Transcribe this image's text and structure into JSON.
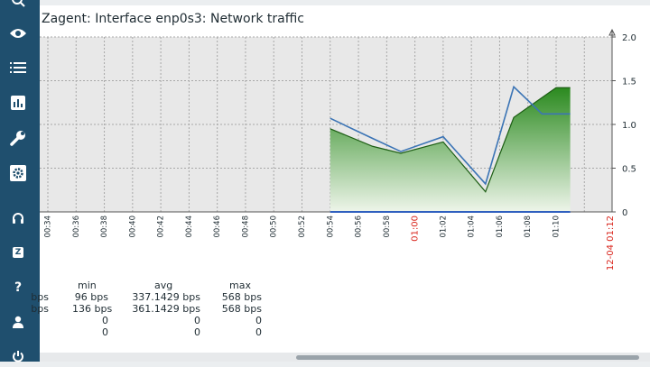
{
  "window": {
    "title": "Zagent: Interface enp0s3: Network traffic"
  },
  "sidebar": {
    "icons": [
      "search-icon",
      "eye-icon",
      "list-icon",
      "chart-icon",
      "wrench-icon",
      "cog-icon",
      "headset-icon",
      "zabbix-icon",
      "help-icon",
      "user-icon",
      "power-icon"
    ],
    "zabbix_label": "Z",
    "help_label": "?"
  },
  "chart_data": {
    "type": "area",
    "title": "Zagent: Interface enp0s3: Network traffic",
    "x": [
      "00:34",
      "00:36",
      "00:38",
      "00:40",
      "00:42",
      "00:44",
      "00:46",
      "00:48",
      "00:50",
      "00:52",
      "00:54",
      "00:56",
      "00:58",
      "01:00",
      "01:02",
      "01:04",
      "01:06",
      "01:08",
      "01:10",
      "12-04 01:12"
    ],
    "highlight_ticks": [
      "01:00",
      "12-04 01:12"
    ],
    "ylim": [
      0,
      2.0
    ],
    "yticks": [
      "0",
      "0.5",
      "1.0",
      "1.5",
      "2.0"
    ],
    "grid": true,
    "series": [
      {
        "style": "area",
        "color": "#2b8a1f",
        "points": [
          [
            "00:54",
            0.95
          ],
          [
            "00:57",
            0.75
          ],
          [
            "00:59",
            0.67
          ],
          [
            "01:02",
            0.8
          ],
          [
            "01:05",
            0.23
          ],
          [
            "01:07",
            1.08
          ],
          [
            "01:10",
            1.42
          ],
          [
            "01:11",
            1.42
          ]
        ]
      },
      {
        "style": "line",
        "color": "#3b74b5",
        "points": [
          [
            "00:54",
            1.07
          ],
          [
            "00:57",
            0.84
          ],
          [
            "00:59",
            0.69
          ],
          [
            "01:02",
            0.86
          ],
          [
            "01:05",
            0.32
          ],
          [
            "01:07",
            1.43
          ],
          [
            "01:09",
            1.12
          ],
          [
            "01:11",
            1.12
          ]
        ]
      }
    ]
  },
  "legend": {
    "headers": [
      "min",
      "avg",
      "max"
    ],
    "rows": [
      {
        "prefix": "bps",
        "min": "96 bps",
        "avg": "337.1429 bps",
        "max": "568 bps"
      },
      {
        "prefix": "bps",
        "min": "136 bps",
        "avg": "361.1429 bps",
        "max": "568 bps"
      },
      {
        "prefix": "",
        "min": "0",
        "avg": "0",
        "max": "0"
      },
      {
        "prefix": "",
        "min": "0",
        "avg": "0",
        "max": "0"
      }
    ]
  },
  "colors": {
    "sidebar": "#1f4f6e",
    "plot_bg": "#e8e8e8",
    "area": "#2b8a1f",
    "line": "#3b74b5",
    "highlight_tick": "#d9251c"
  }
}
